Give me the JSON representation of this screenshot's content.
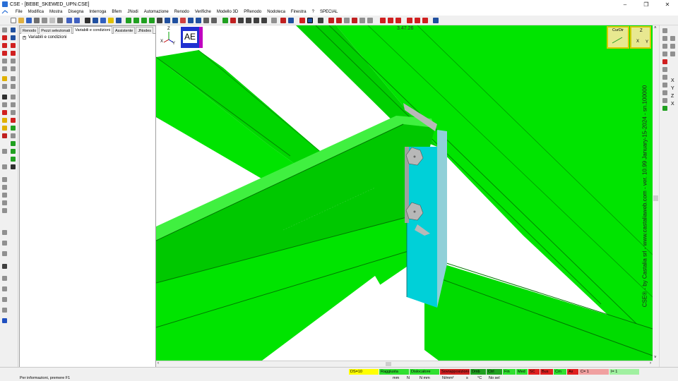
{
  "window": {
    "title": "CSE - [BEBE_SKEWED_UPN.CSE]",
    "buttons": [
      "–",
      "❐",
      "✕"
    ]
  },
  "menu": {
    "items": [
      "File",
      "Modifica",
      "Mostra",
      "Disegna",
      "Interroga",
      "Bfem",
      "JNodi",
      "Automazione",
      "Renodo",
      "Verifiche",
      "Modello 3D",
      "PRenodo",
      "Nodoteca",
      "Finestra",
      "?",
      "SPECIAL"
    ]
  },
  "panel": {
    "tabs": [
      "Renodo",
      "Pezzi selezionati",
      "Variabili e condizioni",
      "Assistente",
      "JNodes"
    ],
    "active_tab": 2,
    "tree_expander": "+",
    "tree_root": "Variabili e condizioni"
  },
  "viewport": {
    "timestamp": "3.47.26",
    "axis_labels": {
      "z": "Z",
      "x": "X",
      "y": "Y"
    },
    "ae_label": "AE",
    "curdir_label": "CurDir",
    "zxy_labels": {
      "z": "Z",
      "x": "X",
      "y": "Y"
    },
    "watermark": "CSE® - by Castalia srl - www.castaliaweb.com - ver. 10.99 January-15-2024 - sn.100000",
    "colors": {
      "beam_face": "#00e400",
      "beam_dark": "#00b800",
      "beam_light": "#40f040",
      "plate": "#00d0d8",
      "bolt": "#b8b8b8"
    }
  },
  "right_toolbar": {
    "axis_letters": [
      "X",
      "Y",
      "Z",
      "X"
    ]
  },
  "status": {
    "message": "Per informazioni, premere F1",
    "cells": [
      "DS=10",
      "Raggiusta",
      "Dislocatore",
      "Sovrapposizioni",
      "Dmb",
      "Ctrl",
      "Fin",
      "Med",
      "SC",
      "Bus",
      "Crn",
      "Ax",
      "C= 1",
      "I= 1"
    ],
    "cell_colors": [
      "#ffff00",
      "#30e030",
      "#30e030",
      "#d02020",
      "#20a020",
      "#20a020",
      "#30e030",
      "#30e030",
      "#e02020",
      "#e02020",
      "#30e030",
      "#e02020",
      "#f0a0a0",
      "#a0f0a0"
    ],
    "units": [
      "mm",
      "N",
      "N mm",
      "N/mm²",
      "s",
      "°C",
      "No sel"
    ]
  }
}
